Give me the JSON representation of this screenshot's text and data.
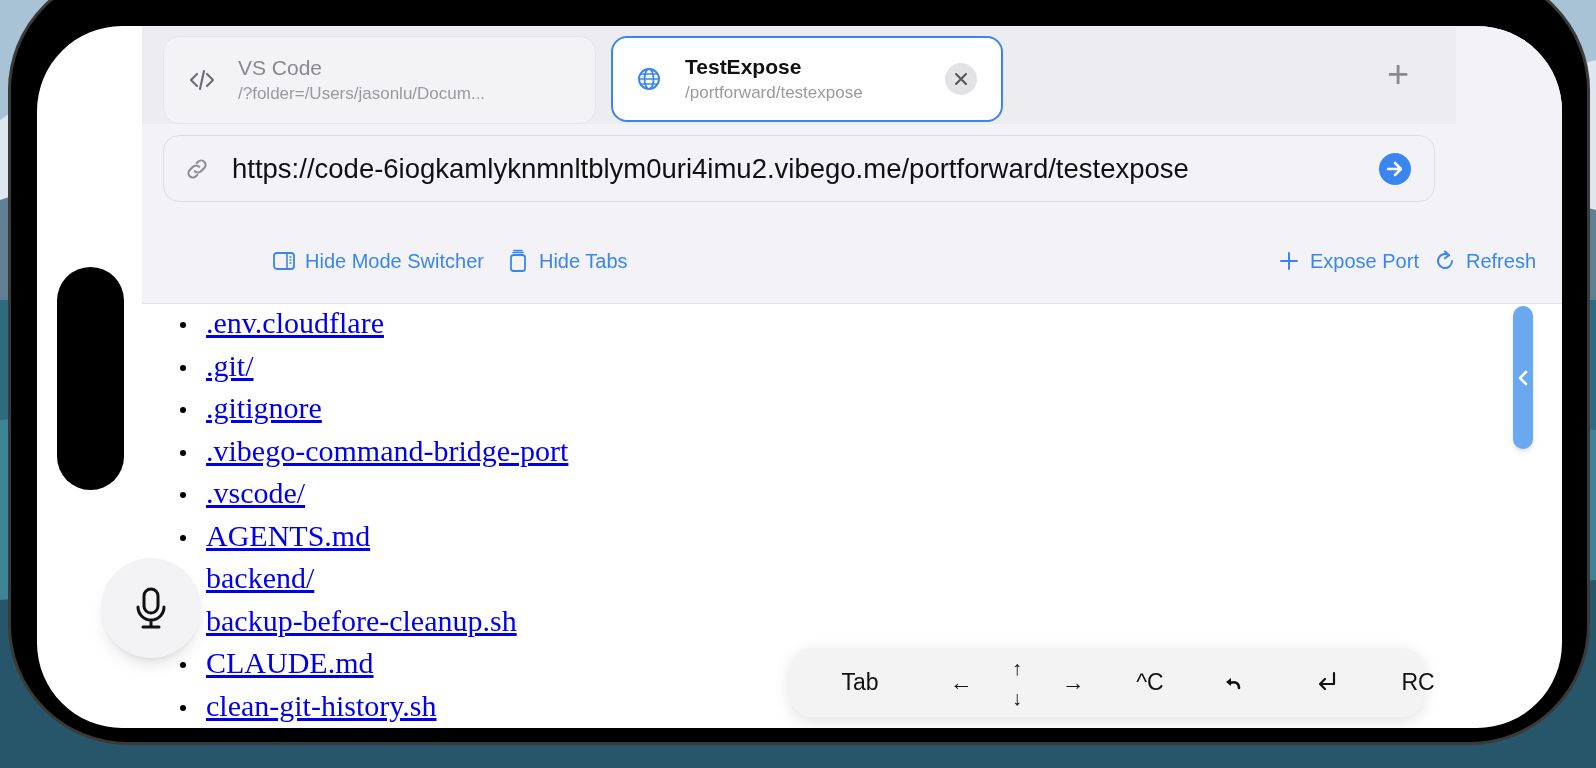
{
  "tabs": [
    {
      "kind": "code",
      "title": "VS Code",
      "subtitle": "/?folder=/Users/jasonlu/Docum...",
      "selected": false
    },
    {
      "kind": "web",
      "title": "TestExpose",
      "subtitle": "/portforward/testexpose",
      "selected": true
    }
  ],
  "new_tab": "+",
  "address_bar": {
    "value": "https://code-6iogkamlyknmnltblym0uri4imu2.vibego.me/portforward/testexpose"
  },
  "actions": [
    {
      "kind": "sidebar",
      "label": "Hide Mode Switcher"
    },
    {
      "kind": "tabs",
      "label": "Hide Tabs"
    },
    {
      "kind": "plus",
      "label": "Expose Port"
    },
    {
      "kind": "refresh",
      "label": "Refresh"
    }
  ],
  "files": [
    ".env.cloudflare",
    ".git/",
    ".gitignore",
    ".vibego-command-bridge-port",
    ".vscode/",
    "AGENTS.md",
    "backend/",
    "backup-before-cleanup.sh",
    "CLAUDE.md",
    "clean-git-history.sh"
  ],
  "keys": [
    {
      "kind": "text",
      "label": "Tab"
    },
    {
      "kind": "text",
      "label": "←"
    },
    {
      "kind": "stack",
      "labels": [
        "↑",
        "↓"
      ]
    },
    {
      "kind": "text",
      "label": "→"
    },
    {
      "kind": "text",
      "label": "^C"
    },
    {
      "kind": "undo"
    },
    {
      "kind": "return"
    },
    {
      "kind": "text",
      "label": "RC"
    }
  ]
}
